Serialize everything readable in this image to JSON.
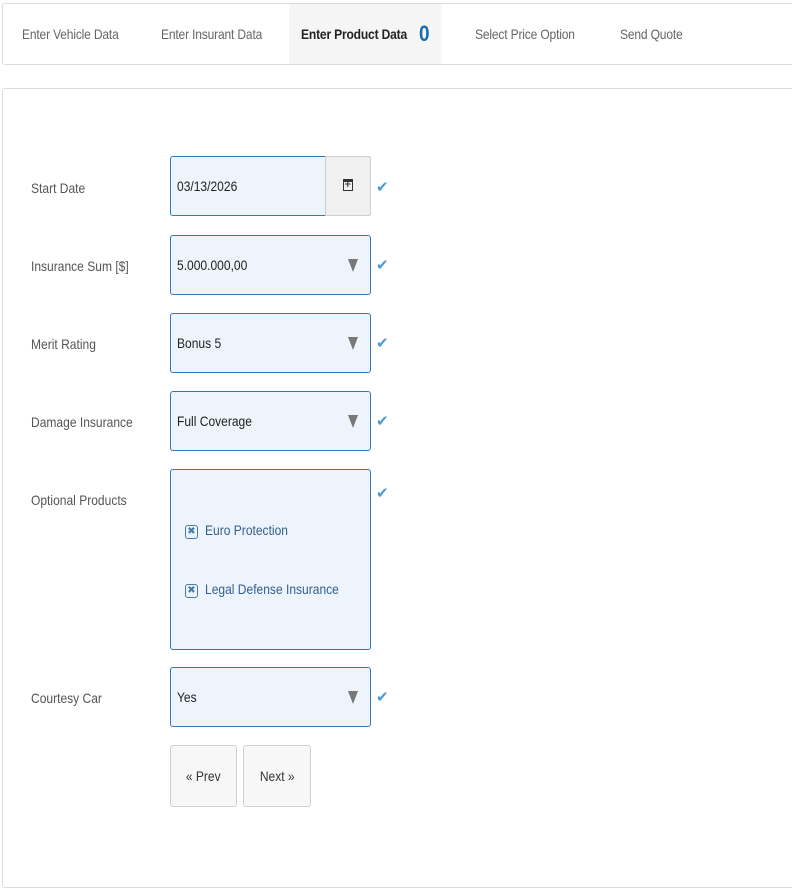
{
  "tabs": [
    {
      "label": "Enter Vehicle Data"
    },
    {
      "label": "Enter Insurant Data"
    },
    {
      "label": "Enter Product Data",
      "count": "0"
    },
    {
      "label": "Select Price Option"
    },
    {
      "label": "Send Quote"
    }
  ],
  "form": {
    "start_date": {
      "label": "Start Date",
      "value": "03/13/2026"
    },
    "insurance_sum": {
      "label": "Insurance Sum [$]",
      "value": "5.000.000,00"
    },
    "merit_rating": {
      "label": "Merit Rating",
      "value": "Bonus 5"
    },
    "damage_insurance": {
      "label": "Damage Insurance",
      "value": "Full Coverage"
    },
    "optional_products": {
      "label": "Optional Products",
      "options": [
        {
          "label": "Euro Protection",
          "mark": "✖"
        },
        {
          "label": "Legal Defense Insurance",
          "mark": "✖"
        }
      ]
    },
    "courtesy_car": {
      "label": "Courtesy Car",
      "value": "Yes"
    },
    "check_glyph": "✔"
  },
  "buttons": {
    "prev": "« Prev",
    "next": "Next »"
  },
  "colors": {
    "accent": "#3a78b5",
    "check": "#4a9ad8",
    "count": "#1a6ab0",
    "field_bg": "#eef4fb"
  }
}
